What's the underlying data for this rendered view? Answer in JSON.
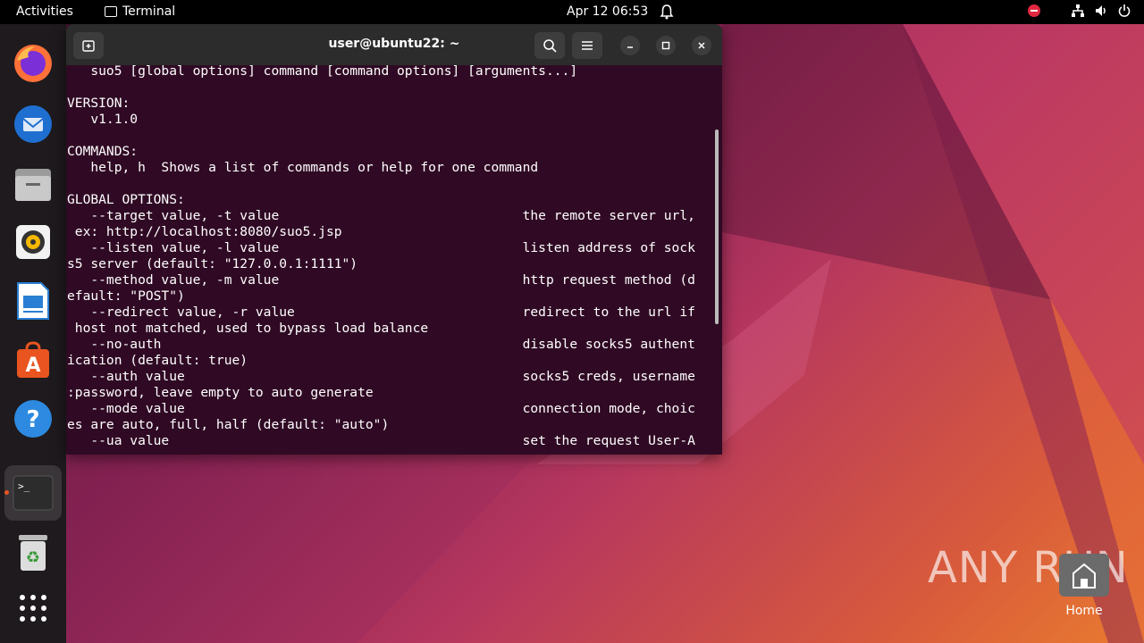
{
  "topbar": {
    "activities": "Activities",
    "app_name": "Terminal",
    "clock": "Apr 12  06:53"
  },
  "window": {
    "title": "user@ubuntu22: ~"
  },
  "terminal_lines": [
    "   suo5 [global options] command [command options] [arguments...]",
    "",
    "VERSION:",
    "   v1.1.0",
    "",
    "COMMANDS:",
    "   help, h  Shows a list of commands or help for one command",
    "",
    "GLOBAL OPTIONS:",
    "   --target value, -t value                               the remote server url,",
    " ex: http://localhost:8080/suo5.jsp",
    "   --listen value, -l value                               listen address of sock",
    "s5 server (default: \"127.0.0.1:1111\")",
    "   --method value, -m value                               http request method (d",
    "efault: \"POST\")",
    "   --redirect value, -r value                             redirect to the url if",
    " host not matched, used to bypass load balance",
    "   --no-auth                                              disable socks5 authent",
    "ication (default: true)",
    "   --auth value                                           socks5 creds, username",
    ":password, leave empty to auto generate",
    "   --mode value                                           connection mode, choic",
    "es are auto, full, half (default: \"auto\")",
    "   --ua value                                             set the request User-A",
    "    "
  ],
  "desktop": {
    "home_label": "Home",
    "watermark": "ANY RUN"
  },
  "dock": [
    {
      "name": "firefox-icon"
    },
    {
      "name": "thunderbird-icon"
    },
    {
      "name": "files-icon"
    },
    {
      "name": "rhythmbox-icon"
    },
    {
      "name": "libreoffice-writer-icon"
    },
    {
      "name": "app-center-icon"
    },
    {
      "name": "help-icon"
    },
    {
      "name": "terminal-icon"
    },
    {
      "name": "trash-icon"
    },
    {
      "name": "show-apps-icon"
    }
  ],
  "colors": {
    "terminal_bg": "#300a24",
    "titlebar_bg": "#2c2c2c",
    "dock_bg": "#1e1a1d",
    "accent": "#e95420"
  }
}
